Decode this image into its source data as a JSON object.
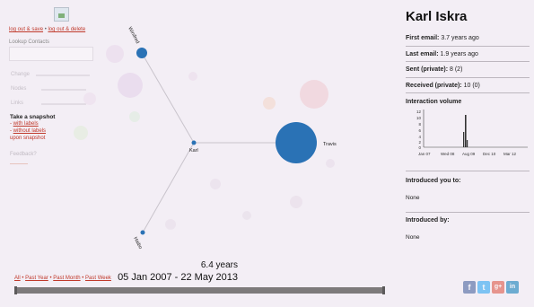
{
  "left": {
    "links_top": [
      "log out & save",
      "log out & delete"
    ],
    "lookup_label": "Lookup Contacts",
    "faded_labels": [
      "Change",
      "Nodes",
      "Links"
    ],
    "snapshot": {
      "title": "Take a snapshot",
      "with_labels": "with labels",
      "without_labels": "without labels",
      "upon": "upon snapshot"
    },
    "feedback": "Feedback?"
  },
  "graph": {
    "nodes": [
      {
        "label": "Karl"
      },
      {
        "label": "Travis"
      },
      {
        "label": "Winifred"
      },
      {
        "label": "Haibo"
      }
    ]
  },
  "timeline": {
    "range_links": [
      "All",
      "Past Year",
      "Past Month",
      "Past Week"
    ],
    "duration": "6.4 years",
    "date_range": "05 Jan 2007 - 22 May 2013"
  },
  "profile": {
    "name": "Karl Iskra",
    "first_email_label": "First email:",
    "first_email_value": "3.7 years ago",
    "last_email_label": "Last email:",
    "last_email_value": "1.9 years ago",
    "sent_label": "Sent (private):",
    "sent_value": "8 (2)",
    "received_label": "Received (private):",
    "received_value": "10 (0)",
    "interaction_title": "Interaction volume",
    "y_ticks": [
      "12",
      "10",
      "8",
      "6",
      "4",
      "2",
      "0"
    ],
    "x_ticks": [
      "Jan 07",
      "Wed 08",
      "Aug 09",
      "Dec 10",
      "Mar 12"
    ],
    "introduced_you_title": "Introduced you to:",
    "introduced_you_value": "None",
    "introduced_by_title": "Introduced by:",
    "introduced_by_value": "None"
  },
  "social": [
    {
      "icon": "facebook-icon",
      "glyph": "f",
      "color": "#3b5998"
    },
    {
      "icon": "twitter-icon",
      "glyph": "t",
      "color": "#1da1f2"
    },
    {
      "icon": "google-plus-icon",
      "glyph": "g+",
      "color": "#dd4b39"
    },
    {
      "icon": "linkedin-icon",
      "glyph": "in",
      "color": "#0077b5"
    }
  ]
}
